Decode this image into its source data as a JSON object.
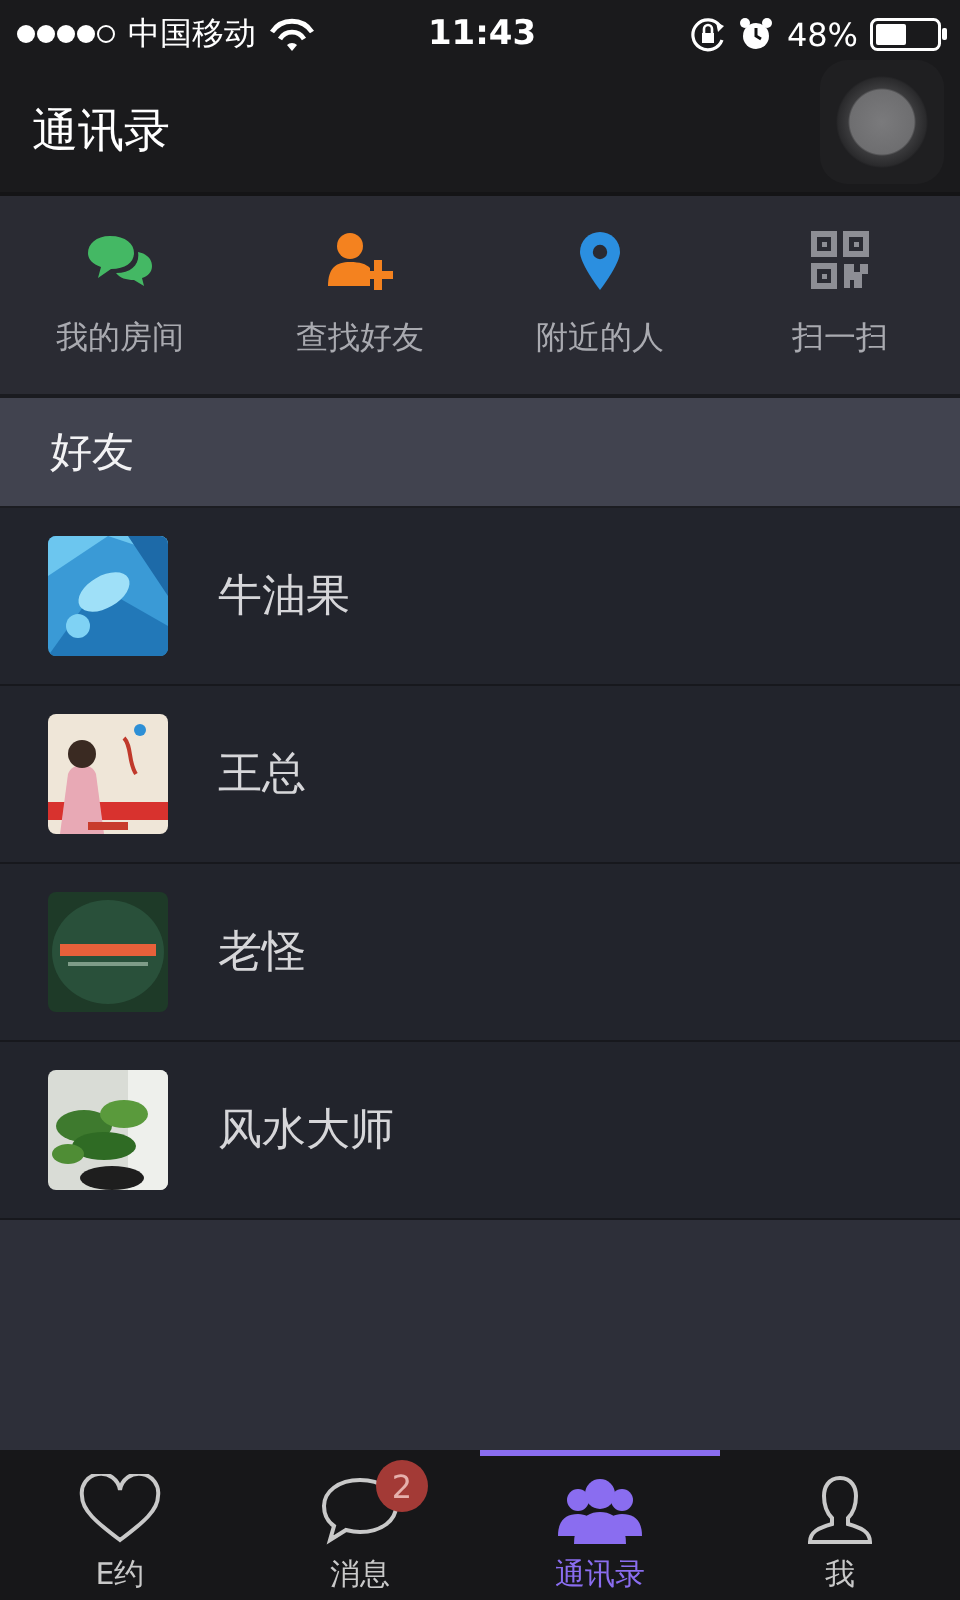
{
  "status_bar": {
    "carrier": "中国移动",
    "time": "11:43",
    "battery": "48%"
  },
  "header": {
    "title": "通讯录"
  },
  "quick_actions": [
    {
      "kind": "chat",
      "label": "我的房间"
    },
    {
      "kind": "add-person",
      "label": "查找好友"
    },
    {
      "kind": "pin",
      "label": "附近的人"
    },
    {
      "kind": "qr",
      "label": "扫一扫"
    }
  ],
  "section": {
    "title": "好友"
  },
  "contacts": [
    {
      "name": "牛油果"
    },
    {
      "name": "王总"
    },
    {
      "name": "老怪"
    },
    {
      "name": "风水大师"
    }
  ],
  "tab_bar": [
    {
      "kind": "heart",
      "label": "E约",
      "selected": false
    },
    {
      "kind": "chat",
      "label": "消息",
      "selected": false,
      "badge": "2"
    },
    {
      "kind": "group",
      "label": "通讯录",
      "selected": true
    },
    {
      "kind": "person",
      "label": "我",
      "selected": false
    }
  ]
}
